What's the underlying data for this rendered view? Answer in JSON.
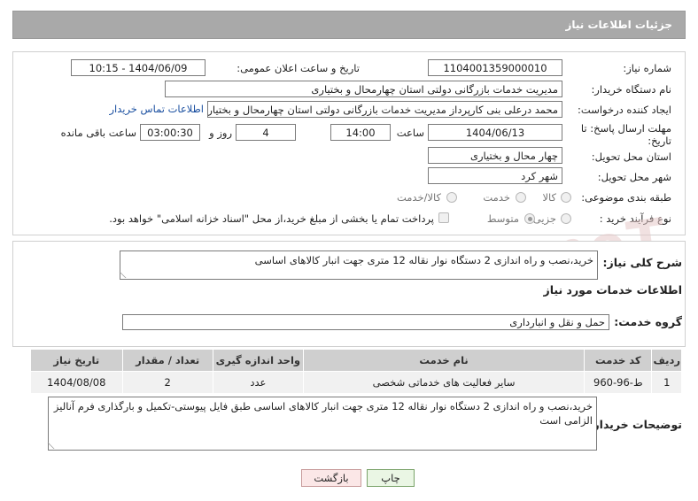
{
  "header": {
    "title": "جزئیات اطلاعات نیاز"
  },
  "fields": {
    "need_number_label": "شماره نیاز:",
    "need_number": "1104001359000010",
    "announce_label": "تاریخ و ساعت اعلان عمومی:",
    "announce_value": "1404/06/09 - 10:15",
    "buyer_org_label": "نام دستگاه خریدار:",
    "buyer_org": "مدیریت خدمات بازرگانی دولتی استان چهارمحال و بختیاری",
    "creator_label": "ایجاد کننده درخواست:",
    "creator": "محمد درعلی بنی کارپرداز مدیریت خدمات بازرگانی دولتی استان چهارمحال و بختیاری",
    "contact_link": "اطلاعات تماس خریدار",
    "deadline_label_1": "مهلت ارسال پاسخ: تا",
    "deadline_label_2": "تاریخ:",
    "deadline_date": "1404/06/13",
    "time_label": "ساعت",
    "deadline_time": "14:00",
    "days_value": "4",
    "days_label": "روز و",
    "remaining_time": "03:00:30",
    "remaining_label": "ساعت باقی مانده",
    "province_label": "استان محل تحویل:",
    "province": "چهار محال و بختیاری",
    "city_label": "شهر محل تحویل:",
    "city": "شهر کرد",
    "category_label": "طبقه بندی موضوعی:",
    "category_opts": [
      "کالا",
      "خدمت",
      "کالا/خدمت"
    ],
    "purchase_label": "نوع فرآیند خرید :",
    "purchase_opts": [
      "جزیی",
      "متوسط"
    ],
    "payment_note": "پرداخت تمام یا بخشی از مبلغ خرید،از محل \"اسناد خزانه اسلامی\" خواهد بود."
  },
  "summary": {
    "label": "شرح کلی نیاز:",
    "text": "خرید،نصب و راه اندازی 2 دستگاه نوار نقاله 12 متری جهت انبار کالاهای اساسی"
  },
  "services": {
    "section_title": "اطلاعات خدمات مورد نیاز",
    "group_label": "گروه خدمت:",
    "group_value": "حمل و نقل و انبارداری",
    "columns": [
      "ردیف",
      "کد خدمت",
      "نام خدمت",
      "واحد اندازه گیری",
      "تعداد / مقدار",
      "تاریخ نیاز"
    ],
    "rows": [
      [
        "1",
        "ط-96-960",
        "سایر فعالیت های خدماتی شخصی",
        "عدد",
        "2",
        "1404/08/08"
      ]
    ]
  },
  "buyer_notes": {
    "label": "توضیحات خریدار:",
    "text": "خرید،نصب و راه اندازی 2 دستگاه نوار نقاله 12 متری جهت انبار کالاهای اساسی طبق فایل پیوستی-تکمیل و بارگذاری فرم آنالیز الزامی است"
  },
  "buttons": {
    "print": "چاپ",
    "back": "بازگشت"
  },
  "watermark": "AriaTender.neT"
}
